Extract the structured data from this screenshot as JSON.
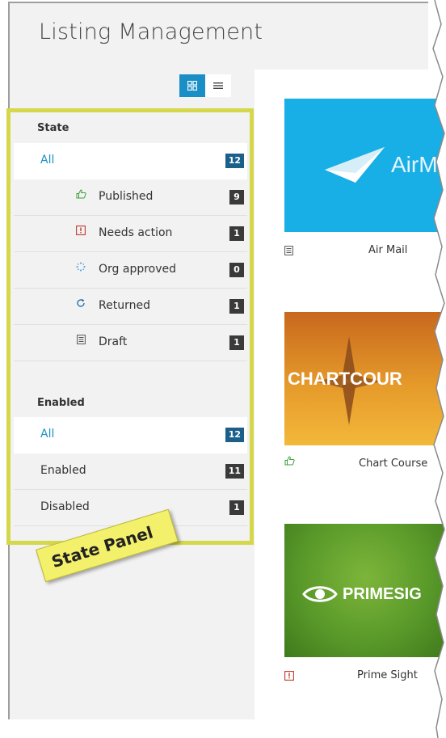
{
  "page_title": "Listing Management",
  "view_toggle": {
    "grid_icon": "grid-icon",
    "list_icon": "list-icon"
  },
  "state_section": {
    "title": "State",
    "items": [
      {
        "label": "All",
        "count": "12",
        "icon": ""
      },
      {
        "label": "Published",
        "count": "9",
        "icon": "thumbs-up-icon"
      },
      {
        "label": "Needs action",
        "count": "1",
        "icon": "alert-icon"
      },
      {
        "label": "Org approved",
        "count": "0",
        "icon": "spinner-icon"
      },
      {
        "label": "Returned",
        "count": "1",
        "icon": "refresh-icon"
      },
      {
        "label": "Draft",
        "count": "1",
        "icon": "document-icon"
      }
    ]
  },
  "enabled_section": {
    "title": "Enabled",
    "items": [
      {
        "label": "All",
        "count": "12"
      },
      {
        "label": "Enabled",
        "count": "11"
      },
      {
        "label": "Disabled",
        "count": "1"
      }
    ]
  },
  "callout": "State Panel",
  "cards": [
    {
      "name": "Air Mail",
      "banner": "AirM",
      "status_icon": "document-icon"
    },
    {
      "name": "Chart Course",
      "banner": "CHARTCOUR",
      "status_icon": "thumbs-up-icon"
    },
    {
      "name": "Prime Sight",
      "banner": "PRIMESIG",
      "status_icon": "alert-icon"
    }
  ],
  "colors": {
    "accent": "#1a8fc6",
    "highlight_border": "#d5d84a",
    "alert": "#c0392b",
    "published": "#3aa03a",
    "orgapproved": "#3a9ad9"
  }
}
